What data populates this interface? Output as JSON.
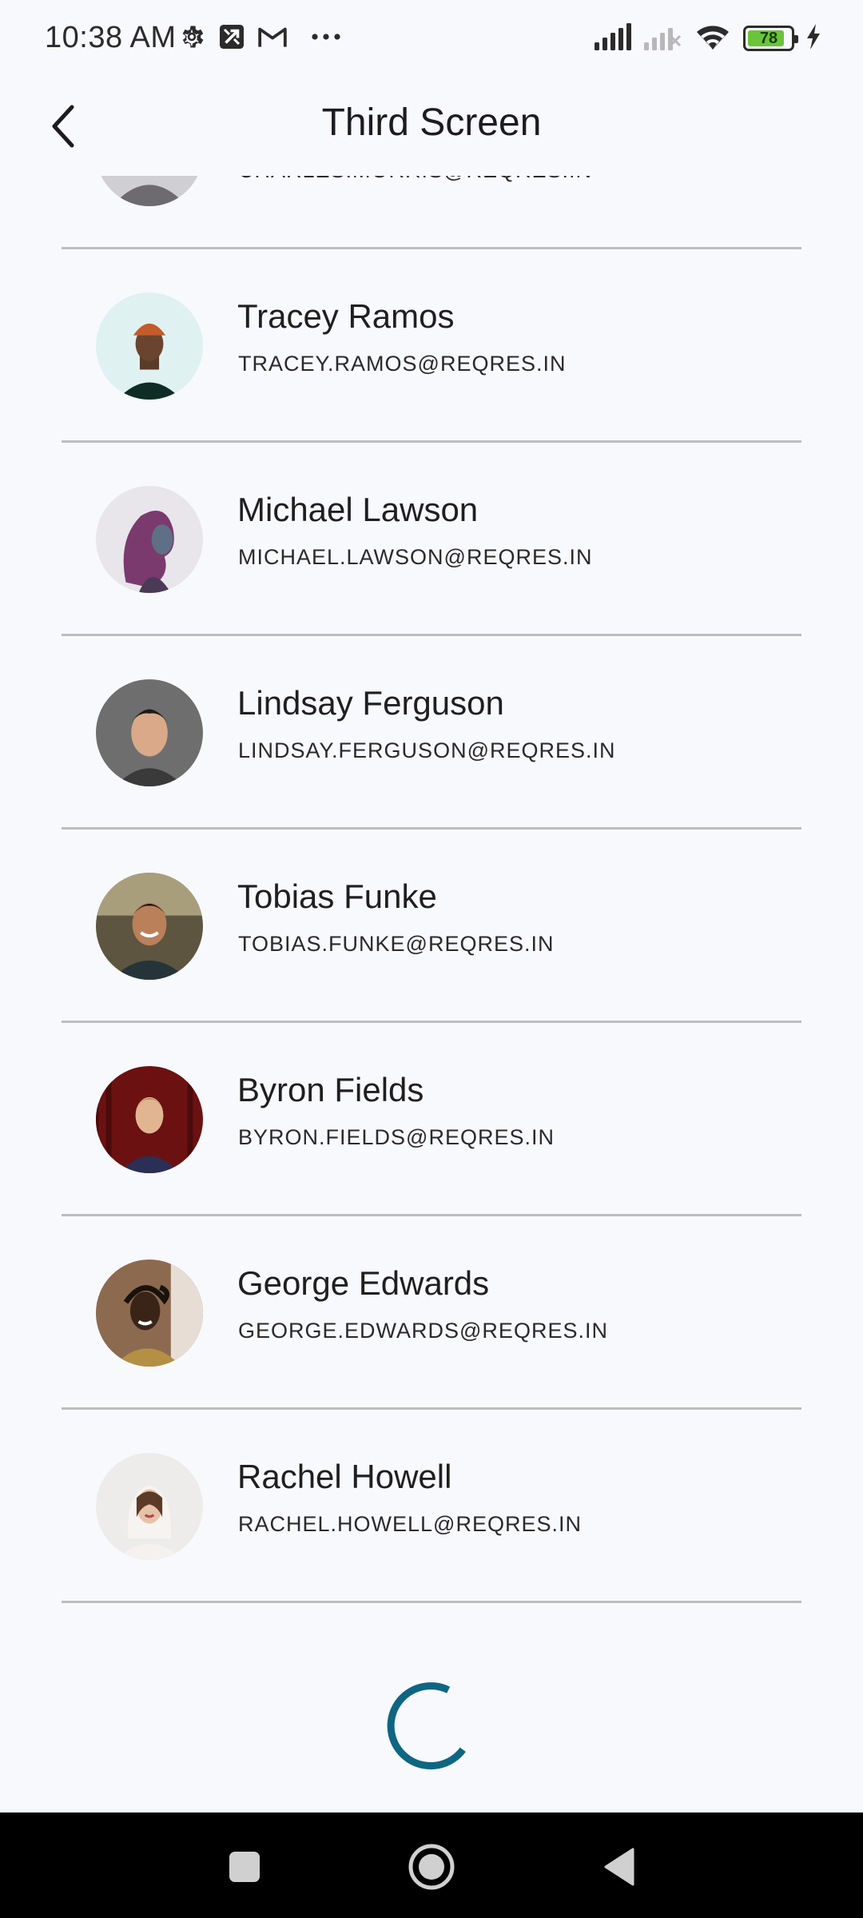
{
  "status_bar": {
    "time": "10:38 AM",
    "battery_level": "78",
    "battery_fraction": 0.78,
    "left_icons": [
      "settings-gear-icon",
      "cast-icon",
      "gmail-icon",
      "more-dots-icon"
    ],
    "right_icons": [
      "signal-icon",
      "signal-off-icon",
      "wifi-icon",
      "battery-icon",
      "charging-bolt-icon"
    ]
  },
  "app_bar": {
    "title": "Third Screen",
    "back_icon": "back-chevron-icon"
  },
  "users": [
    {
      "name": "",
      "email": "CHARLES.MORRIS@REQRES.IN"
    },
    {
      "name": "Tracey Ramos",
      "email": "TRACEY.RAMOS@REQRES.IN"
    },
    {
      "name": "Michael Lawson",
      "email": "MICHAEL.LAWSON@REQRES.IN"
    },
    {
      "name": "Lindsay Ferguson",
      "email": "LINDSAY.FERGUSON@REQRES.IN"
    },
    {
      "name": "Tobias Funke",
      "email": "TOBIAS.FUNKE@REQRES.IN"
    },
    {
      "name": "Byron Fields",
      "email": "BYRON.FIELDS@REQRES.IN"
    },
    {
      "name": "George Edwards",
      "email": "GEORGE.EDWARDS@REQRES.IN"
    },
    {
      "name": "Rachel Howell",
      "email": "RACHEL.HOWELL@REQRES.IN"
    }
  ],
  "loading": {
    "icon": "loading-spinner-icon"
  },
  "nav_bar": {
    "buttons": [
      "recents-square-icon",
      "home-circle-icon",
      "back-triangle-icon"
    ]
  },
  "colors": {
    "background": "#f8f9fd",
    "spinner": "#0e6682",
    "divider": "#bdbdbd",
    "battery_fill": "#6ac43b"
  }
}
